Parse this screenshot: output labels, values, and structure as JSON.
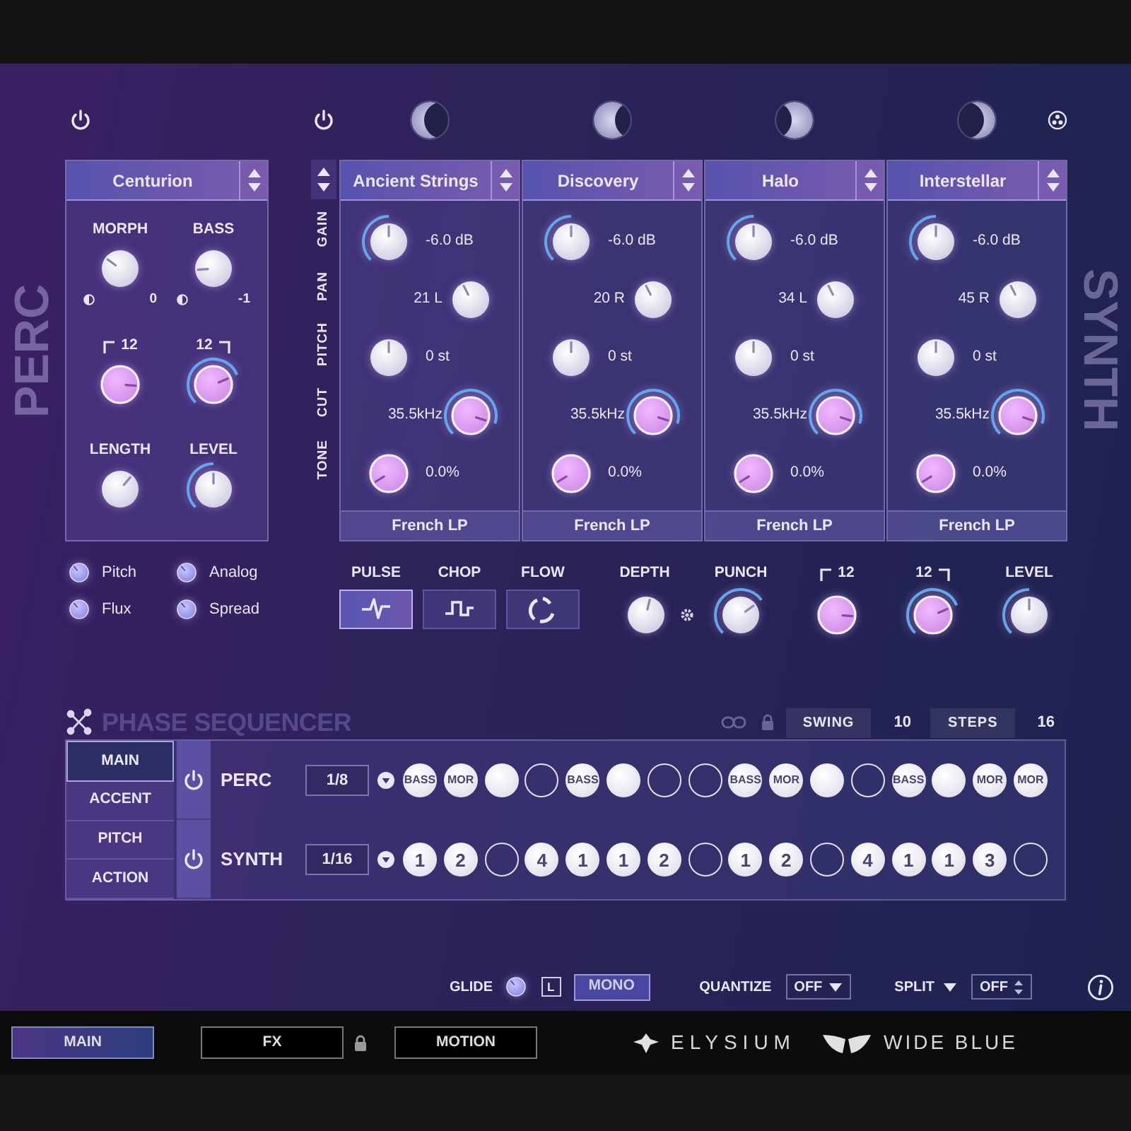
{
  "perc": {
    "title": "PERC",
    "preset": "Centurion",
    "knobs": [
      {
        "label": "MORPH",
        "kind": "morph",
        "ring": false,
        "sub": "0"
      },
      {
        "label": "BASS",
        "kind": "bass",
        "ring": false,
        "sub": "-1"
      },
      {
        "label": "12",
        "kind": "hp",
        "ring": false
      },
      {
        "label": "12",
        "kind": "lp",
        "ring": true
      },
      {
        "label": "LENGTH",
        "kind": "length",
        "ring": false
      },
      {
        "label": "LEVEL",
        "kind": "white",
        "ring": true
      }
    ],
    "options": [
      {
        "label": "Pitch"
      },
      {
        "label": "Analog"
      },
      {
        "label": "Flux"
      },
      {
        "label": "Spread"
      }
    ]
  },
  "synth": {
    "title": "SYNTH",
    "params": [
      {
        "label": "GAIN",
        "kind": "gain"
      },
      {
        "label": "PAN",
        "kind": "pan"
      },
      {
        "label": "PITCH",
        "kind": "pitch"
      },
      {
        "label": "CUT",
        "kind": "cutoff"
      },
      {
        "label": "TONE",
        "kind": "tone"
      }
    ],
    "layers": [
      {
        "name": "Ancient Strings",
        "filter": "French LP",
        "values": [
          {
            "text": "-6.0 dB",
            "ring": true
          },
          {
            "text": "21 L",
            "ring": false
          },
          {
            "text": "0 st",
            "ring": false
          },
          {
            "text": "35.5kHz",
            "ring": true
          },
          {
            "text": "0.0%",
            "ring": false
          }
        ]
      },
      {
        "name": "Discovery",
        "filter": "French LP",
        "values": [
          {
            "text": "-6.0 dB",
            "ring": true
          },
          {
            "text": "20 R",
            "ring": false
          },
          {
            "text": "0 st",
            "ring": false
          },
          {
            "text": "35.5kHz",
            "ring": true
          },
          {
            "text": "0.0%",
            "ring": false
          }
        ]
      },
      {
        "name": "Halo",
        "filter": "French LP",
        "values": [
          {
            "text": "-6.0 dB",
            "ring": true
          },
          {
            "text": "34 L",
            "ring": false
          },
          {
            "text": "0 st",
            "ring": false
          },
          {
            "text": "35.5kHz",
            "ring": true
          },
          {
            "text": "0.0%",
            "ring": false
          }
        ]
      },
      {
        "name": "Interstellar",
        "filter": "French LP",
        "values": [
          {
            "text": "-6.0 dB",
            "ring": true
          },
          {
            "text": "45 R",
            "ring": false
          },
          {
            "text": "0 st",
            "ring": false
          },
          {
            "text": "35.5kHz",
            "ring": true
          },
          {
            "text": "0.0%",
            "ring": false
          }
        ]
      }
    ],
    "modes": [
      {
        "label": "PULSE",
        "kind": "pulse",
        "selected": true
      },
      {
        "label": "CHOP",
        "kind": "chop",
        "selected": false
      },
      {
        "label": "FLOW",
        "kind": "flow",
        "selected": false
      }
    ],
    "macros": [
      {
        "label": "DEPTH",
        "kind": "depth",
        "ring": false
      },
      {
        "label": "PUNCH",
        "kind": "punch",
        "ring": true
      },
      {
        "label": "12",
        "kind": "hp",
        "ring": false
      },
      {
        "label": "12",
        "kind": "lp",
        "ring": true
      },
      {
        "label": "LEVEL",
        "kind": "white",
        "ring": true
      }
    ]
  },
  "sequencer": {
    "title": "PHASE SEQUENCER",
    "swing_label": "SWING",
    "swing": "10",
    "steps_label": "STEPS",
    "steps": "16",
    "tabs": [
      {
        "label": "MAIN",
        "selected": true
      },
      {
        "label": "ACCENT",
        "selected": false
      },
      {
        "label": "PITCH",
        "selected": false
      },
      {
        "label": "ACTION",
        "selected": false
      }
    ],
    "rows": [
      {
        "name": "PERC",
        "rate": "1/8",
        "steps": [
          {
            "filled": true,
            "label": "BASS"
          },
          {
            "filled": true,
            "label": "MOR"
          },
          {
            "filled": true
          },
          {
            "filled": false
          },
          {
            "filled": true,
            "label": "BASS"
          },
          {
            "filled": true
          },
          {
            "filled": false
          },
          {
            "filled": false
          },
          {
            "filled": true,
            "label": "BASS"
          },
          {
            "filled": true,
            "label": "MOR"
          },
          {
            "filled": true
          },
          {
            "filled": false
          },
          {
            "filled": true,
            "label": "BASS"
          },
          {
            "filled": true
          },
          {
            "filled": true,
            "label": "MOR"
          },
          {
            "filled": true,
            "label": "MOR"
          }
        ]
      },
      {
        "name": "SYNTH",
        "rate": "1/16",
        "steps": [
          {
            "filled": true,
            "label": "1"
          },
          {
            "filled": true,
            "label": "2"
          },
          {
            "filled": false
          },
          {
            "filled": true,
            "label": "4"
          },
          {
            "filled": true,
            "label": "1"
          },
          {
            "filled": true,
            "label": "1"
          },
          {
            "filled": true,
            "label": "2"
          },
          {
            "filled": false
          },
          {
            "filled": true,
            "label": "1"
          },
          {
            "filled": true,
            "label": "2"
          },
          {
            "filled": false
          },
          {
            "filled": true,
            "label": "4"
          },
          {
            "filled": true,
            "label": "1"
          },
          {
            "filled": true,
            "label": "1"
          },
          {
            "filled": true,
            "label": "3"
          },
          {
            "filled": false
          }
        ]
      }
    ]
  },
  "footer": {
    "glide_label": "GLIDE",
    "legato": "L",
    "mono": {
      "label": "MONO",
      "on": true
    },
    "quantize_label": "QUANTIZE",
    "quantize": "OFF",
    "split_label": "SPLIT",
    "split": "OFF"
  },
  "nav": [
    {
      "label": "MAIN",
      "selected": true,
      "locked": false
    },
    {
      "label": "FX",
      "selected": false,
      "locked": true
    },
    {
      "label": "MOTION",
      "selected": false,
      "locked": false
    }
  ],
  "brands": [
    {
      "name": "ELYSIUM",
      "kind": "elysium"
    },
    {
      "name": "WIDE BLUE",
      "kind": "wideblue"
    }
  ]
}
